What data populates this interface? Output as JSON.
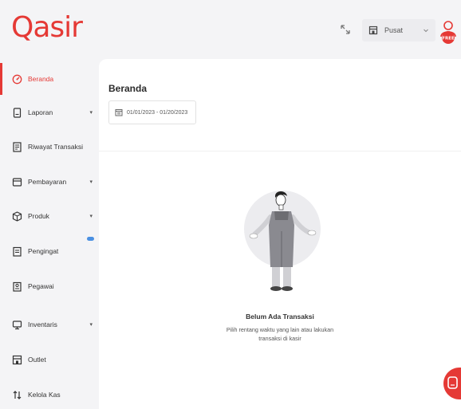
{
  "brand": {
    "logo_text": "Qasir",
    "accent": "#e53935"
  },
  "header": {
    "outlet_label": "Pusat",
    "avatar_badge": "FREE"
  },
  "sidebar": {
    "items": [
      {
        "label": "Beranda",
        "icon": "dashboard-icon",
        "active": true
      },
      {
        "label": "Laporan",
        "icon": "report-icon",
        "has_caret": true
      },
      {
        "label": "Riwayat Transaksi",
        "icon": "history-icon"
      },
      {
        "label": "Pembayaran",
        "icon": "payment-icon",
        "has_caret": true
      },
      {
        "label": "Produk",
        "icon": "product-icon",
        "has_caret": true
      },
      {
        "label": "Pengingat",
        "icon": "reminder-icon",
        "badge": "new"
      },
      {
        "label": "Pegawai",
        "icon": "employee-icon"
      },
      {
        "label": "Inventaris",
        "icon": "inventory-icon",
        "has_caret": true
      },
      {
        "label": "Outlet",
        "icon": "outlet-icon"
      },
      {
        "label": "Kelola Kas",
        "icon": "cash-icon"
      }
    ],
    "caret": "▾"
  },
  "main": {
    "title": "Beranda",
    "date_range": "01/01/2023 - 01/20/2023",
    "empty_state": {
      "title": "Belum Ada Transaksi",
      "desc_line1": "Pilih rentang waktu yang lain atau lakukan",
      "desc_line2": "transaksi di kasir"
    }
  }
}
